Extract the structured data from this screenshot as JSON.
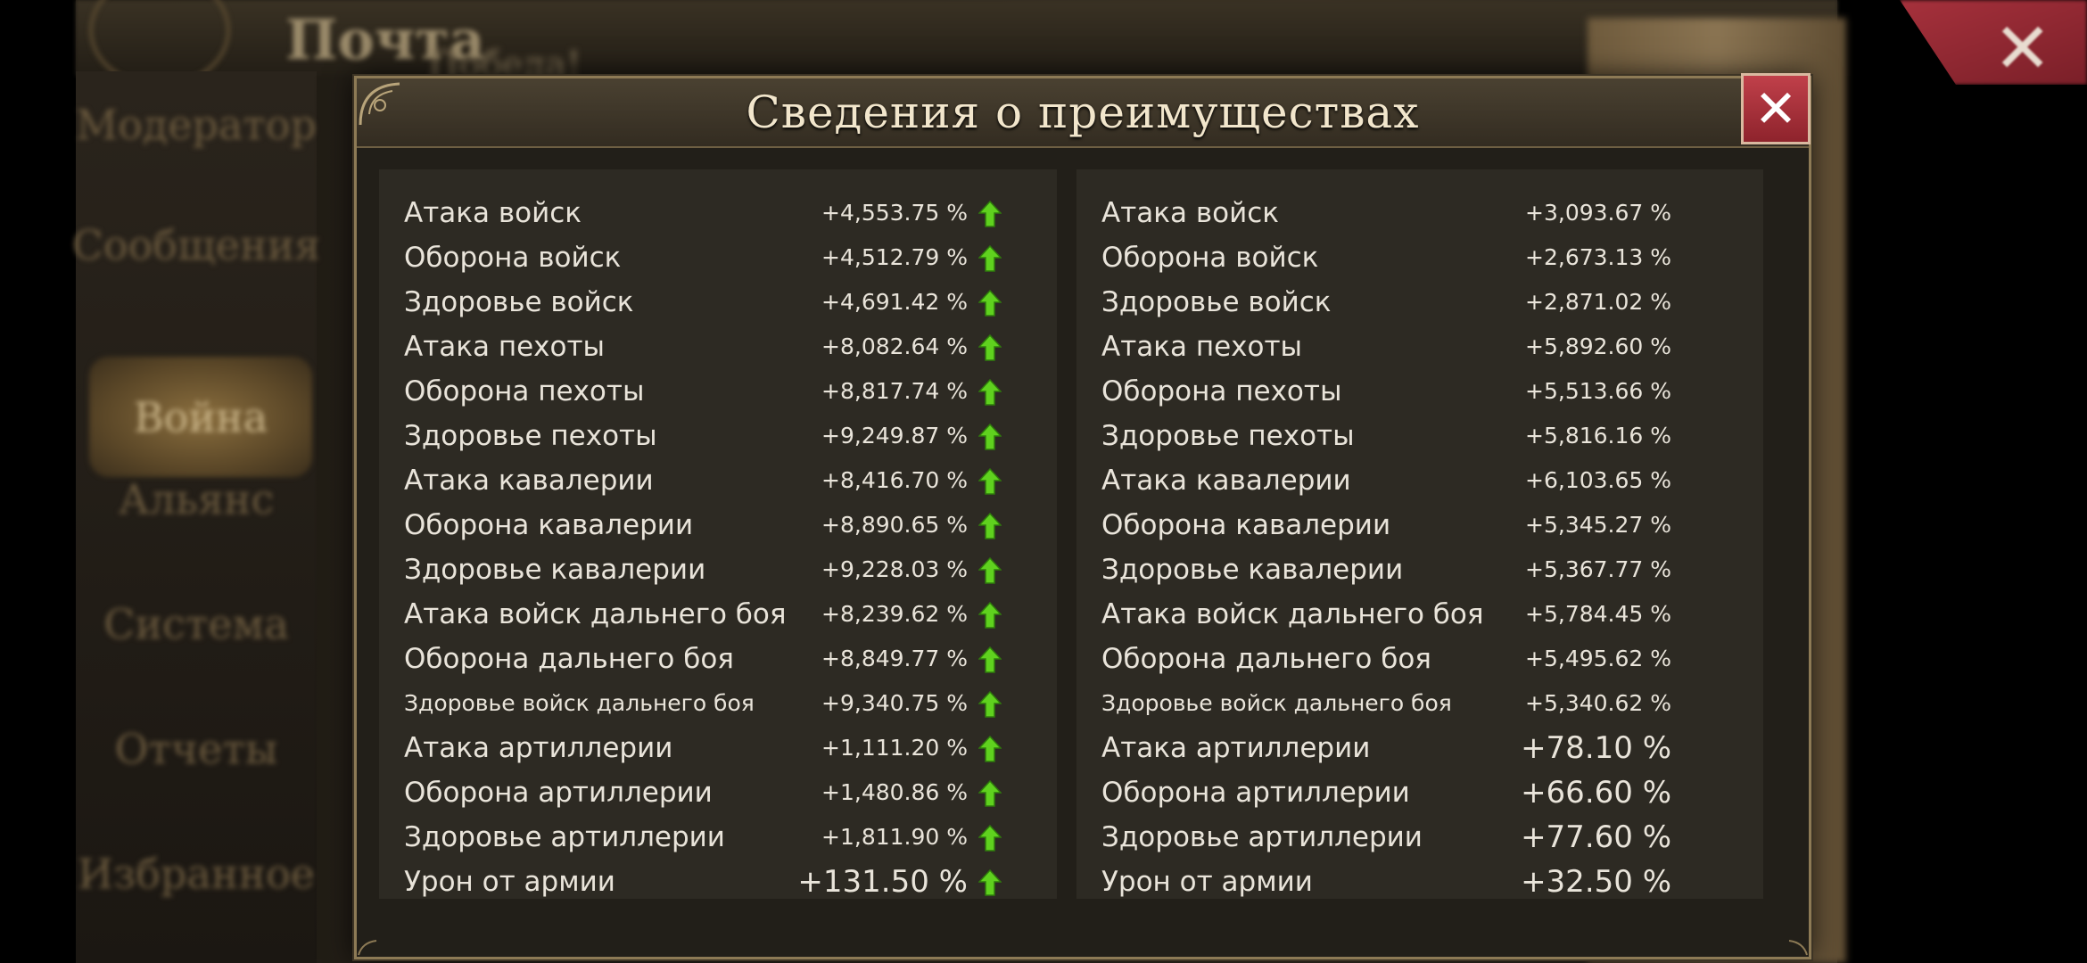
{
  "background": {
    "title": "Почта",
    "subtitle": "Победа!",
    "sidebar": [
      "Модератор",
      "Сообщения",
      "Война",
      "Альянс",
      "Система",
      "Отчеты",
      "Избранное"
    ],
    "active_index": 2
  },
  "modal": {
    "title": "Сведения о преимуществах",
    "close_icon": "close-icon",
    "left": [
      {
        "label": "Атака войск",
        "value": "+4,553.75 %"
      },
      {
        "label": "Оборона войск",
        "value": "+4,512.79 %"
      },
      {
        "label": "Здоровье войск",
        "value": "+4,691.42 %"
      },
      {
        "label": "Атака пехоты",
        "value": "+8,082.64 %"
      },
      {
        "label": "Оборона пехоты",
        "value": "+8,817.74 %"
      },
      {
        "label": "Здоровье пехоты",
        "value": "+9,249.87 %"
      },
      {
        "label": "Атака кавалерии",
        "value": "+8,416.70 %"
      },
      {
        "label": "Оборона кавалерии",
        "value": "+8,890.65 %"
      },
      {
        "label": "Здоровье кавалерии",
        "value": "+9,228.03 %"
      },
      {
        "label": "Атака войск дальнего боя",
        "value": "+8,239.62 %"
      },
      {
        "label": "Оборона дальнего боя",
        "value": "+8,849.77 %"
      },
      {
        "label": "Здоровье войск дальнего боя",
        "value": "+9,340.75 %"
      },
      {
        "label": "Атака артиллерии",
        "value": "+1,111.20 %"
      },
      {
        "label": "Оборона артиллерии",
        "value": "+1,480.86 %"
      },
      {
        "label": "Здоровье артиллерии",
        "value": "+1,811.90 %"
      },
      {
        "label": "Урон от армии",
        "value": "+131.50 %"
      }
    ],
    "right": [
      {
        "label": "Атака войск",
        "value": "+3,093.67 %"
      },
      {
        "label": "Оборона войск",
        "value": "+2,673.13 %"
      },
      {
        "label": "Здоровье войск",
        "value": "+2,871.02 %"
      },
      {
        "label": "Атака пехоты",
        "value": "+5,892.60 %"
      },
      {
        "label": "Оборона пехоты",
        "value": "+5,513.66 %"
      },
      {
        "label": "Здоровье пехоты",
        "value": "+5,816.16 %"
      },
      {
        "label": "Атака кавалерии",
        "value": "+6,103.65 %"
      },
      {
        "label": "Оборона кавалерии",
        "value": "+5,345.27 %"
      },
      {
        "label": "Здоровье кавалерии",
        "value": "+5,367.77 %"
      },
      {
        "label": "Атака войск дальнего боя",
        "value": "+5,784.45 %"
      },
      {
        "label": "Оборона дальнего боя",
        "value": "+5,495.62 %"
      },
      {
        "label": "Здоровье войск дальнего боя",
        "value": "+5,340.62 %"
      },
      {
        "label": "Атака артиллерии",
        "value": "+78.10 %"
      },
      {
        "label": "Оборона артиллерии",
        "value": "+66.60 %"
      },
      {
        "label": "Здоровье артиллерии",
        "value": "+77.60 %"
      },
      {
        "label": "Урон от армии",
        "value": "+32.50 %"
      }
    ],
    "advantage_icon": "green-up-arrow-icon",
    "colors": {
      "text": "#e9e4da",
      "title": "#f2e6cc",
      "arrow": "#5fd11e",
      "close": "#b3353f"
    }
  }
}
